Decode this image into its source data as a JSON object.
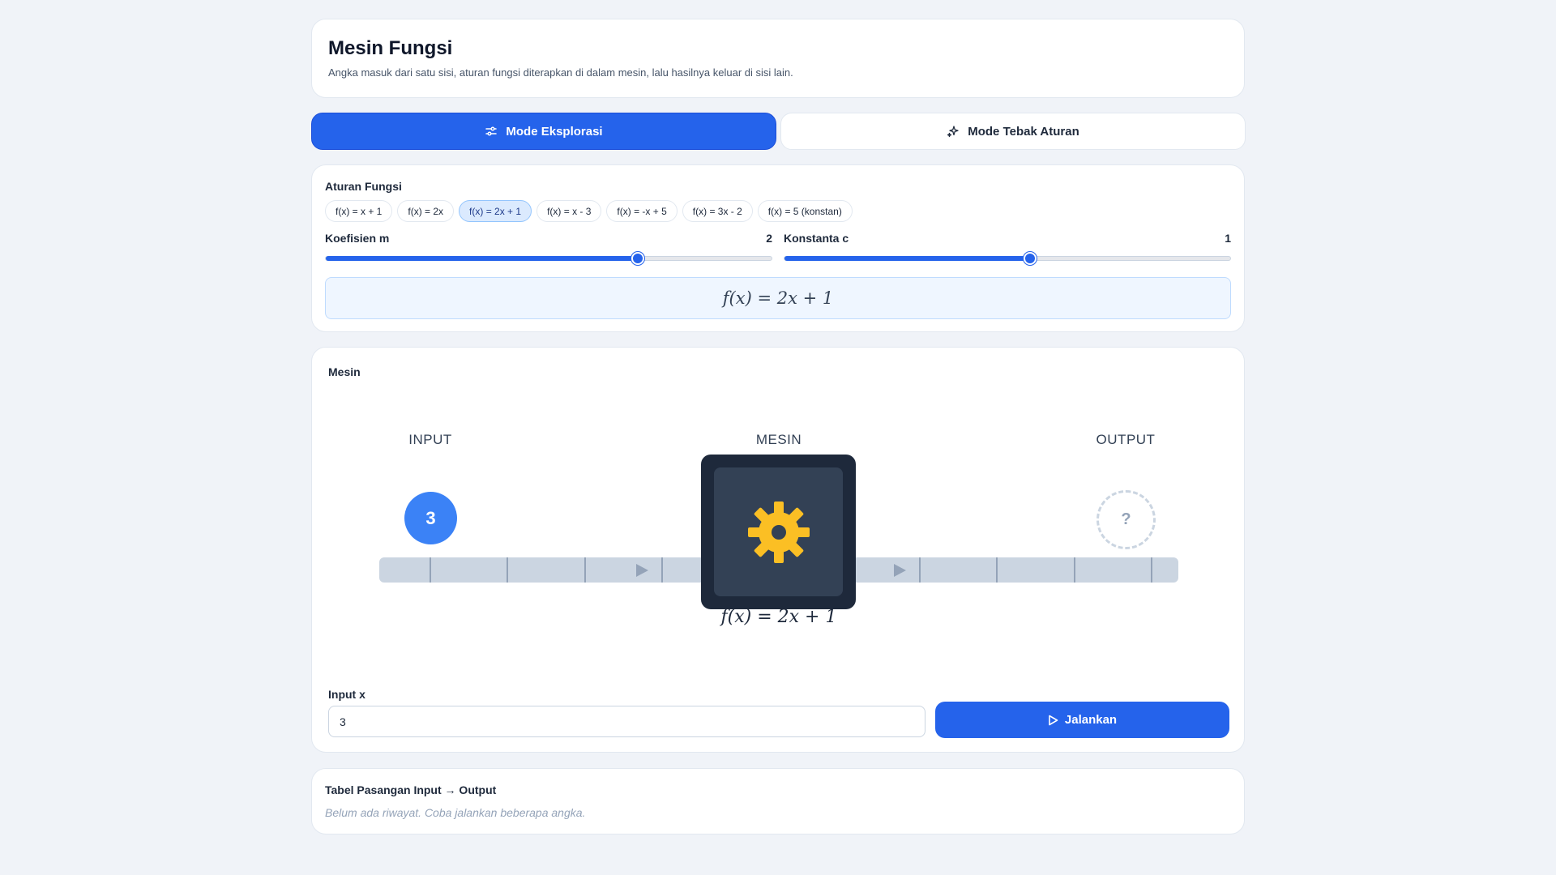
{
  "header": {
    "title": "Mesin Fungsi",
    "subtitle": "Angka masuk dari satu sisi, aturan fungsi diterapkan di dalam mesin, lalu hasilnya keluar di sisi lain."
  },
  "modes": [
    {
      "label": "Mode Eksplorasi",
      "icon": "sliders-icon",
      "active": true
    },
    {
      "label": "Mode Tebak Aturan",
      "icon": "sparkles-icon",
      "active": false
    }
  ],
  "rule": {
    "label": "Aturan Fungsi",
    "presets": [
      "f(x) = x + 1",
      "f(x) = 2x",
      "f(x) = 2x + 1",
      "f(x) = x - 3",
      "f(x) = -x + 5",
      "f(x) = 3x - 2",
      "f(x) = 5 (konstan)"
    ],
    "active_index": 2,
    "coef_m": {
      "label": "Koefisien m",
      "value": "2",
      "fraction": 0.7
    },
    "const_c": {
      "label": "Konstanta c",
      "value": "1",
      "fraction": 0.55
    },
    "formula": "f(x) = 2x + 1"
  },
  "machine": {
    "label": "Mesin",
    "input_label": "INPUT",
    "machine_label": "MESIN",
    "output_label": "OUTPUT",
    "input_value": "3",
    "output_value": "?",
    "formula": "f(x) = 2x + 1",
    "colors": {
      "gear": "#fbbf24",
      "machine_body": "#1e293b",
      "ball": "#3b82f6"
    }
  },
  "controls": {
    "input_label": "Input x",
    "input_value": "3",
    "run_label": "Jalankan"
  },
  "table": {
    "title": "Tabel Pasangan Input → Output",
    "empty_text": "Belum ada riwayat. Coba jalankan beberapa angka."
  }
}
